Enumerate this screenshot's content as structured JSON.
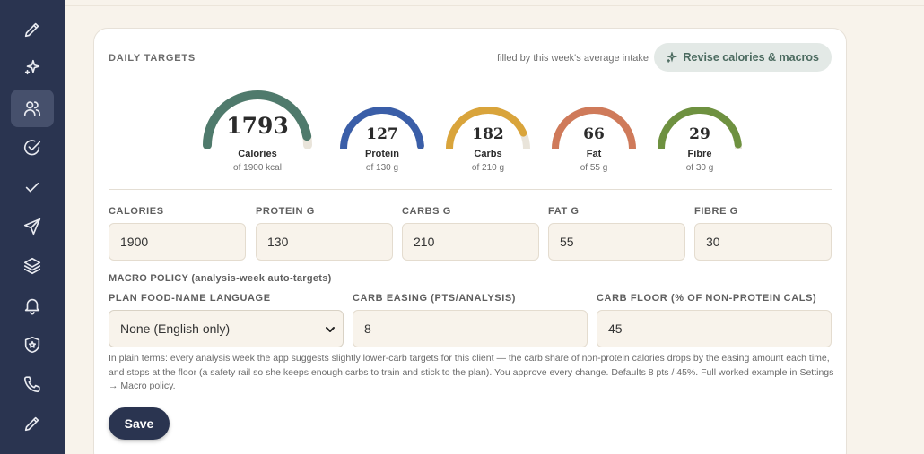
{
  "sidebar": {
    "items": [
      {
        "icon": "pencil-icon",
        "active": false
      },
      {
        "icon": "sparkle-icon",
        "active": false
      },
      {
        "icon": "users-icon",
        "active": true
      },
      {
        "icon": "check-circle-icon",
        "active": false
      },
      {
        "icon": "check-icon",
        "active": false
      },
      {
        "icon": "send-icon",
        "active": false
      },
      {
        "icon": "layers-icon",
        "active": false
      },
      {
        "icon": "bell-icon",
        "active": false
      },
      {
        "icon": "shield-star-icon",
        "active": false
      },
      {
        "icon": "phone-icon",
        "active": false
      },
      {
        "icon": "pencil-icon",
        "active": false
      }
    ]
  },
  "card": {
    "title": "DAILY TARGETS",
    "fill_note": "filled by this week's average intake",
    "revise_label": "Revise calories & macros"
  },
  "gauges": [
    {
      "value": "1793",
      "label": "Calories",
      "sub": "of 1900 kcal",
      "fraction": 0.944,
      "color": "#4f7a6c"
    },
    {
      "value": "127",
      "label": "Protein",
      "sub": "of 130 g",
      "fraction": 0.977,
      "color": "#3a5ea8"
    },
    {
      "value": "182",
      "label": "Carbs",
      "sub": "of 210 g",
      "fraction": 0.867,
      "color": "#d9a43b"
    },
    {
      "value": "66",
      "label": "Fat",
      "sub": "of 55 g",
      "fraction": 1.0,
      "color": "#cf7a5a"
    },
    {
      "value": "29",
      "label": "Fibre",
      "sub": "of 30 g",
      "fraction": 0.967,
      "color": "#6e9140"
    }
  ],
  "fields": [
    {
      "label": "CALORIES",
      "value": "1900"
    },
    {
      "label": "PROTEIN G",
      "value": "130"
    },
    {
      "label": "CARBS G",
      "value": "210"
    },
    {
      "label": "FAT G",
      "value": "55"
    },
    {
      "label": "FIBRE G",
      "value": "30"
    }
  ],
  "policy": {
    "title": "MACRO POLICY (analysis-week auto-targets)",
    "language_label": "PLAN FOOD-NAME LANGUAGE",
    "language_value": "None (English only)",
    "easing_label": "CARB EASING (PTS/ANALYSIS)",
    "easing_value": "8",
    "floor_label": "CARB FLOOR (% OF NON-PROTEIN CALS)",
    "floor_value": "45",
    "explanation": "In plain terms: every analysis week the app suggests slightly lower-carb targets for this client — the carb share of non-protein calories drops by the easing amount each time, and stops at the floor (a safety rail so she keeps enough carbs to train and stick to the plan). You approve every change. Defaults 8 pts / 45%. Full worked example in Settings → Macro policy."
  },
  "save_label": "Save",
  "colors": {
    "sidebar_bg": "#2a3450",
    "page_bg": "#f8f3eb",
    "track": "#e9e4da"
  }
}
